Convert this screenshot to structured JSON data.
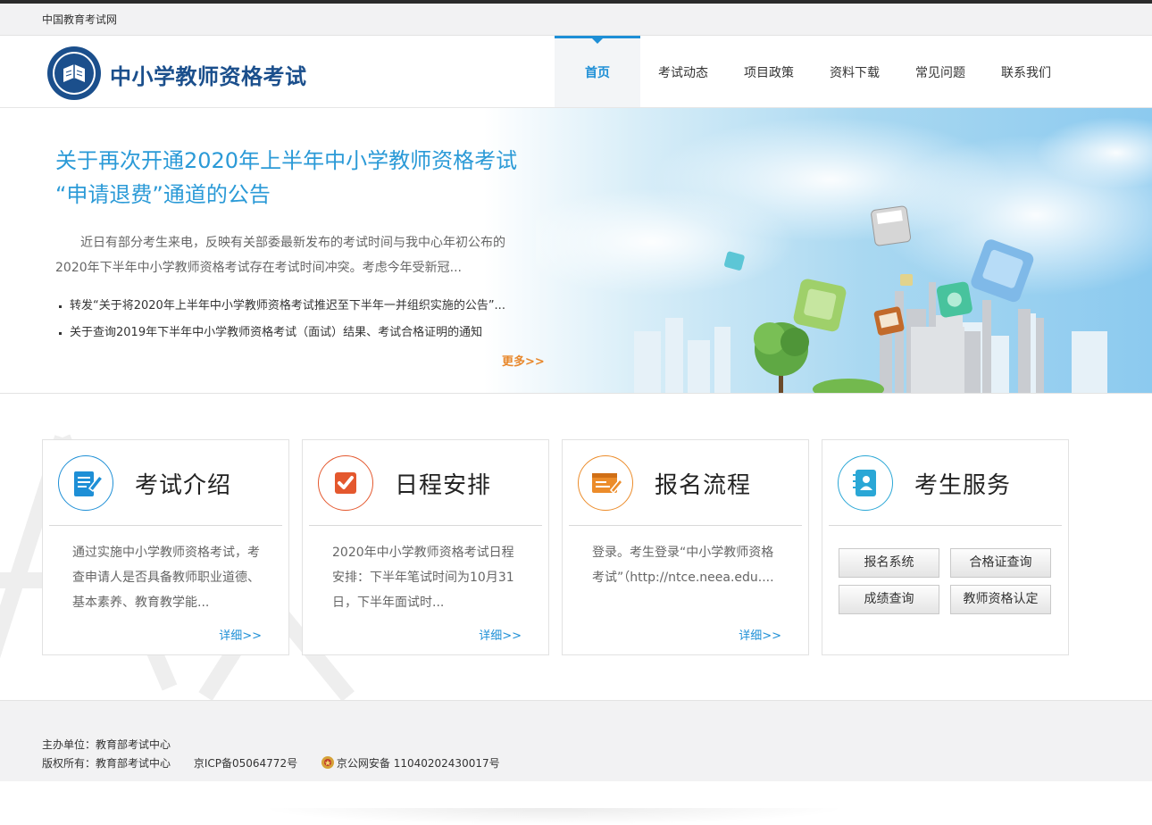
{
  "topbar": {
    "site_link": "中国教育考试网"
  },
  "header": {
    "title": "中小学教师资格考试",
    "nav": [
      {
        "label": "首页",
        "active": true
      },
      {
        "label": "考试动态",
        "active": false
      },
      {
        "label": "项目政策",
        "active": false
      },
      {
        "label": "资料下载",
        "active": false
      },
      {
        "label": "常见问题",
        "active": false
      },
      {
        "label": "联系我们",
        "active": false
      }
    ]
  },
  "banner": {
    "title_line1": "关于再次开通2020年上半年中小学教师资格考试",
    "title_line2": "“申请退费”通道的公告",
    "description": "近日有部分考生来电，反映有关部委最新发布的考试时间与我中心年初公布的2020年下半年中小学教师资格考试存在考试时间冲突。考虑今年受新冠...",
    "news": [
      "转发“关于将2020年上半年中小学教师资格考试推迟至下半年一并组织实施的公告”...",
      "关于查询2019年下半年中小学教师资格考试（面试）结果、考试合格证明的通知"
    ],
    "more": "更多>>"
  },
  "cards": [
    {
      "title": "考试介绍",
      "icon": "document-edit-icon",
      "text": "通过实施中小学教师资格考试，考查申请人是否具备教师职业道德、基本素养、教育教学能...",
      "more": "详细>>",
      "color": "#1e8fd6"
    },
    {
      "title": "日程安排",
      "icon": "checkmark-icon",
      "text": "2020年中小学教师资格考试日程安排：下半年笔试时间为10月31日，下半年面试时...",
      "more": "详细>>",
      "color": "#e4582e"
    },
    {
      "title": "报名流程",
      "icon": "form-edit-icon",
      "text": "登录。考生登录“中小学教师资格考试”（http://ntce.neea.edu....",
      "more": "详细>>",
      "color": "#ec8c2a"
    },
    {
      "title": "考生服务",
      "icon": "contact-book-icon",
      "color": "#2aa7d6",
      "buttons": [
        "报名系统",
        "合格证查询",
        "成绩查询",
        "教师资格认定"
      ]
    }
  ],
  "footer": {
    "sponsor": "主办单位：教育部考试中心",
    "copyright": "版权所有：教育部考试中心",
    "icp": "京ICP备05064772号",
    "police": "京公网安备 11040202430017号"
  }
}
